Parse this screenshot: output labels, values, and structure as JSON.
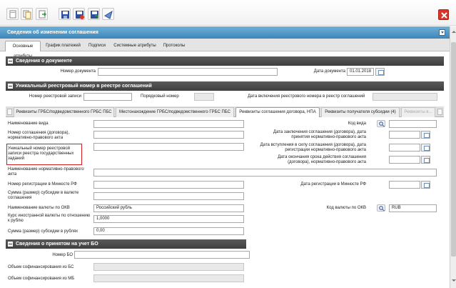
{
  "toolbar": {
    "buttons": [
      {
        "icon": "page-icon"
      },
      {
        "icon": "document-copy-icon"
      },
      {
        "icon": "page-arrow-icon"
      },
      {
        "icon": "save-icon"
      },
      {
        "icon": "save-close-icon"
      },
      {
        "icon": "save-as-icon"
      },
      {
        "icon": "send-icon"
      }
    ],
    "close_icon": "close-icon"
  },
  "window": {
    "title": "Сведения об изменении соглашения"
  },
  "top_tabs": [
    "Основные атрибуты",
    "График платежей",
    "Подписи",
    "Системные атрибуты",
    "Протоколы"
  ],
  "doc_section": {
    "title": "Сведения о документе",
    "doc_number_label": "Номер документа",
    "doc_number_value": "",
    "doc_date_label": "Дата документа",
    "doc_date_value": "01.01.2018"
  },
  "registry_section": {
    "title": "Уникальный реестровый номер в реестре соглашений",
    "registry_number_label": "Номер реестровой записи",
    "seq_number_label": "Порядковый номер",
    "inclusion_date_label": "Дата включения реестрового номера в реестр соглашений"
  },
  "mid_tabs": [
    "Реквизиты ГРБС/подведомственного ГРБС ПБС",
    "Местонахождение ГРБС/подведомственного ГРБС ПБС",
    "Реквизиты соглашения договора, НПА",
    "Реквизиты получателя субсидии (4)",
    "Реквизиты в..."
  ],
  "form": {
    "kind_name_label": "Наименование вида",
    "kind_code_label": "Код вида",
    "agreement_number_label": "Номер соглашения (договора), нормативно-правового акта",
    "conclusion_date_label": "Дата заключения соглашения (договора), дата принятия нормативно-правового акта",
    "unique_registry_label": "Уникальный номер реестровой записи реестра государственных заданий",
    "effective_date_label": "Дата вступления в силу соглашения (договора), дата регистрации нормативно-правового акта",
    "expiry_date_label": "Дата окончания срока действия соглашения (договора), нормативно-правового акта",
    "npa_name_label": "Наименование нормативно-правового акта",
    "minjust_number_label": "Номер регистрации в Минюсте РФ",
    "minjust_date_label": "Дата регистрации в Минюсте РФ",
    "subsidy_currency_label": "Сумма (размер) субсидии в валюте соглашения",
    "currency_name_label": "Наименование валюты по ОКВ",
    "currency_name_value": "Российский рубль",
    "currency_code_label": "Код валюты по ОКВ",
    "currency_code_value": "RUB",
    "exchange_rate_label": "Курс иностранной валюты по отношению к рублю",
    "exchange_rate_value": "1,0000",
    "subsidy_rub_label": "Сумма (размер) субсидии в рублях",
    "subsidy_rub_value": "0,00"
  },
  "bo_section": {
    "title": "Сведения о принятом на учет БО",
    "bo_number_label": "Номер БО",
    "cofin_bs_label": "Объем софинансирования из БС",
    "cofin_mb_label": "Объем софинансирования из МБ"
  },
  "colors": {
    "titlebar": "#3d86b8",
    "section": "#4a4a4a",
    "highlight": "#d11f1f",
    "close": "#d9362b"
  }
}
